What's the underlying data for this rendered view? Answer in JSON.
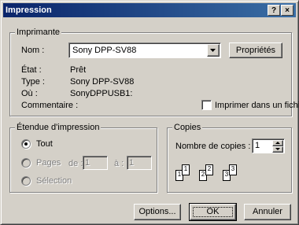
{
  "window": {
    "title": "Impression",
    "help_button": "?",
    "close_button": "×"
  },
  "printer": {
    "group_label": "Imprimante",
    "name_label": "Nom :",
    "name_value": "Sony DPP-SV88",
    "properties_button": "Propriétés",
    "status_label": "État :",
    "status_value": "Prêt",
    "type_label": "Type :",
    "type_value": "Sony DPP-SV88",
    "where_label": "Où :",
    "where_value": "SonyDPPUSB1:",
    "comment_label": "Commentaire :",
    "print_to_file_label": "Imprimer dans un fichier",
    "print_to_file_checked": false
  },
  "range": {
    "group_label": "Étendue d'impression",
    "all_label": "Tout",
    "all_selected": true,
    "pages_label": "Pages",
    "from_label": "de :",
    "from_value": "1",
    "to_label": "à :",
    "to_value": "1",
    "selection_label": "Sélection"
  },
  "copies": {
    "group_label": "Copies",
    "count_label": "Nombre de copies :",
    "count_value": "1",
    "collate_pages": [
      "1",
      "1",
      "2",
      "2",
      "3",
      "3"
    ]
  },
  "buttons": {
    "options": "Options...",
    "ok": "OK",
    "cancel": "Annuler"
  },
  "colors": {
    "titlebar_start": "#0a246a",
    "titlebar_end": "#3a6ea5",
    "face": "#d4d0c8"
  }
}
